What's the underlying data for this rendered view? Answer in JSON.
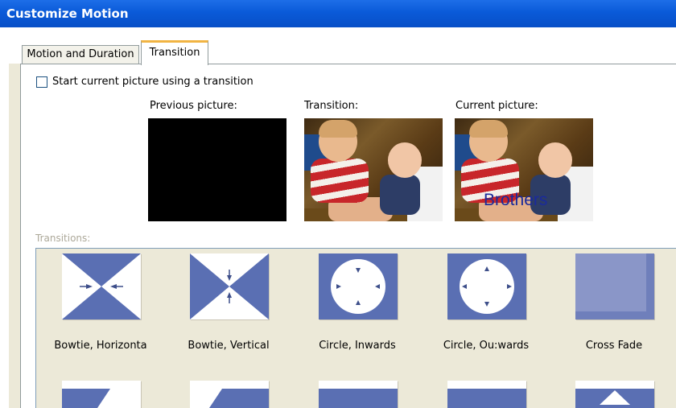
{
  "window": {
    "title": "Customize Motion"
  },
  "tabs": [
    {
      "label": "Motion and Duration",
      "selected": false
    },
    {
      "label": "Transition",
      "selected": true
    }
  ],
  "checkbox": {
    "label": "Start current picture using a transition",
    "checked": false
  },
  "previews": {
    "previous_label": "Previous picture:",
    "transition_label": "Transition:",
    "current_label": "Current picture:",
    "current_overlay_text": "Brothers"
  },
  "transitions": {
    "label": "Transitions:",
    "items": [
      {
        "label": "Bowtie, Horizonta",
        "icon": "bowtie-horizontal-icon"
      },
      {
        "label": "Bowtie, Vertical",
        "icon": "bowtie-vertical-icon"
      },
      {
        "label": "Circle, Inwards",
        "icon": "circle-inwards-icon"
      },
      {
        "label": "Circle, Ou:wards",
        "icon": "circle-outwards-icon"
      },
      {
        "label": "Cross Fade",
        "icon": "cross-fade-icon"
      }
    ]
  },
  "colors": {
    "accent": "#5a6fb3",
    "titlebar": "#0a5ad8",
    "tab_highlight": "#f1b443"
  }
}
